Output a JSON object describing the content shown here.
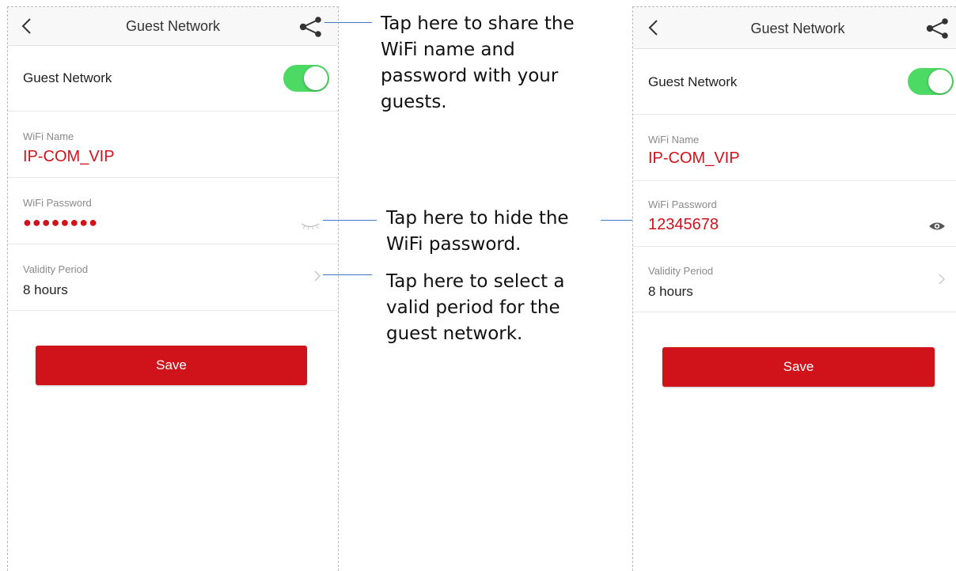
{
  "left_screen": {
    "header": {
      "title": "Guest Network"
    },
    "guest_network_label": "Guest Network",
    "guest_network_enabled": true,
    "wifi_name_label": "WiFi Name",
    "wifi_name_value": "IP-COM_VIP",
    "wifi_password_label": "WiFi Password",
    "wifi_password_value": "●●●●●●●●",
    "validity_period_label": "Validity Period",
    "validity_period_value": "8 hours",
    "save_label": "Save"
  },
  "right_screen": {
    "header": {
      "title": "Guest Network"
    },
    "guest_network_label": "Guest Network",
    "guest_network_enabled": true,
    "wifi_name_label": "WiFi Name",
    "wifi_name_value": "IP-COM_VIP",
    "wifi_password_label": "WiFi Password",
    "wifi_password_value": "12345678",
    "validity_period_label": "Validity Period",
    "validity_period_value": "8 hours",
    "save_label": "Save"
  },
  "annotations": {
    "share": [
      "Tap here to share the",
      "WiFi name and",
      "password with your",
      "guests."
    ],
    "hide": [
      "Tap here to hide the",
      "WiFi password."
    ],
    "validity": [
      "Tap here to select a",
      "valid period for the",
      "guest network."
    ]
  },
  "icons": {
    "back": "chevron-left-icon",
    "share": "share-icon",
    "password_hidden": "eye-closed-icon",
    "password_visible": "eye-icon",
    "row_chevron": "chevron-right-icon"
  },
  "colors": {
    "accent_red": "#d0121b",
    "toggle_on": "#4cd964",
    "callout_line": "#3d7bc8",
    "nav_background": "#f8f8f8"
  }
}
